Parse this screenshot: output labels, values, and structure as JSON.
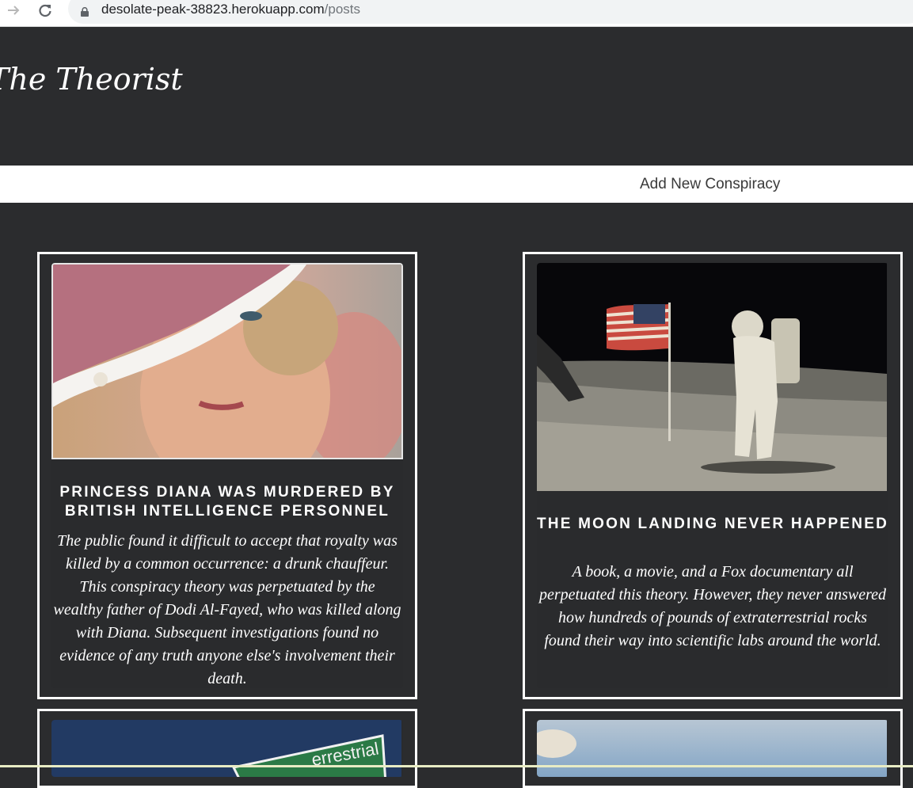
{
  "browser": {
    "url_host": "desolate-peak-38823.herokuapp.com",
    "url_path": "/posts",
    "forward_icon": "arrow-right-icon",
    "reload_icon": "reload-icon",
    "lock_icon": "lock-icon"
  },
  "header": {
    "site_title": "The Theorist"
  },
  "nav": {
    "add_new_label": "Add New Conspiracy"
  },
  "posts": [
    {
      "title": "PRINCESS DIANA WAS MURDERED BY BRITISH INTELLIGENCE PERSONNEL",
      "body": "The public found it difficult to accept that royalty was killed by a common occurrence: a drunk chauffeur. This conspiracy theory was perpetuated by the wealthy father of Dodi Al-Fayed, who was killed along with Diana. Subsequent investigations found no evidence of any truth anyone else's involvement their death."
    },
    {
      "title": "THE MOON LANDING NEVER HAPPENED",
      "body": "A book, a movie, and a Fox documentary all perpetuated this theory. However, they never answered how hundreds of pounds of extraterrestrial rocks found their way into scientific labs around the world."
    },
    {
      "image_sign_text": "errestrial"
    },
    {}
  ]
}
